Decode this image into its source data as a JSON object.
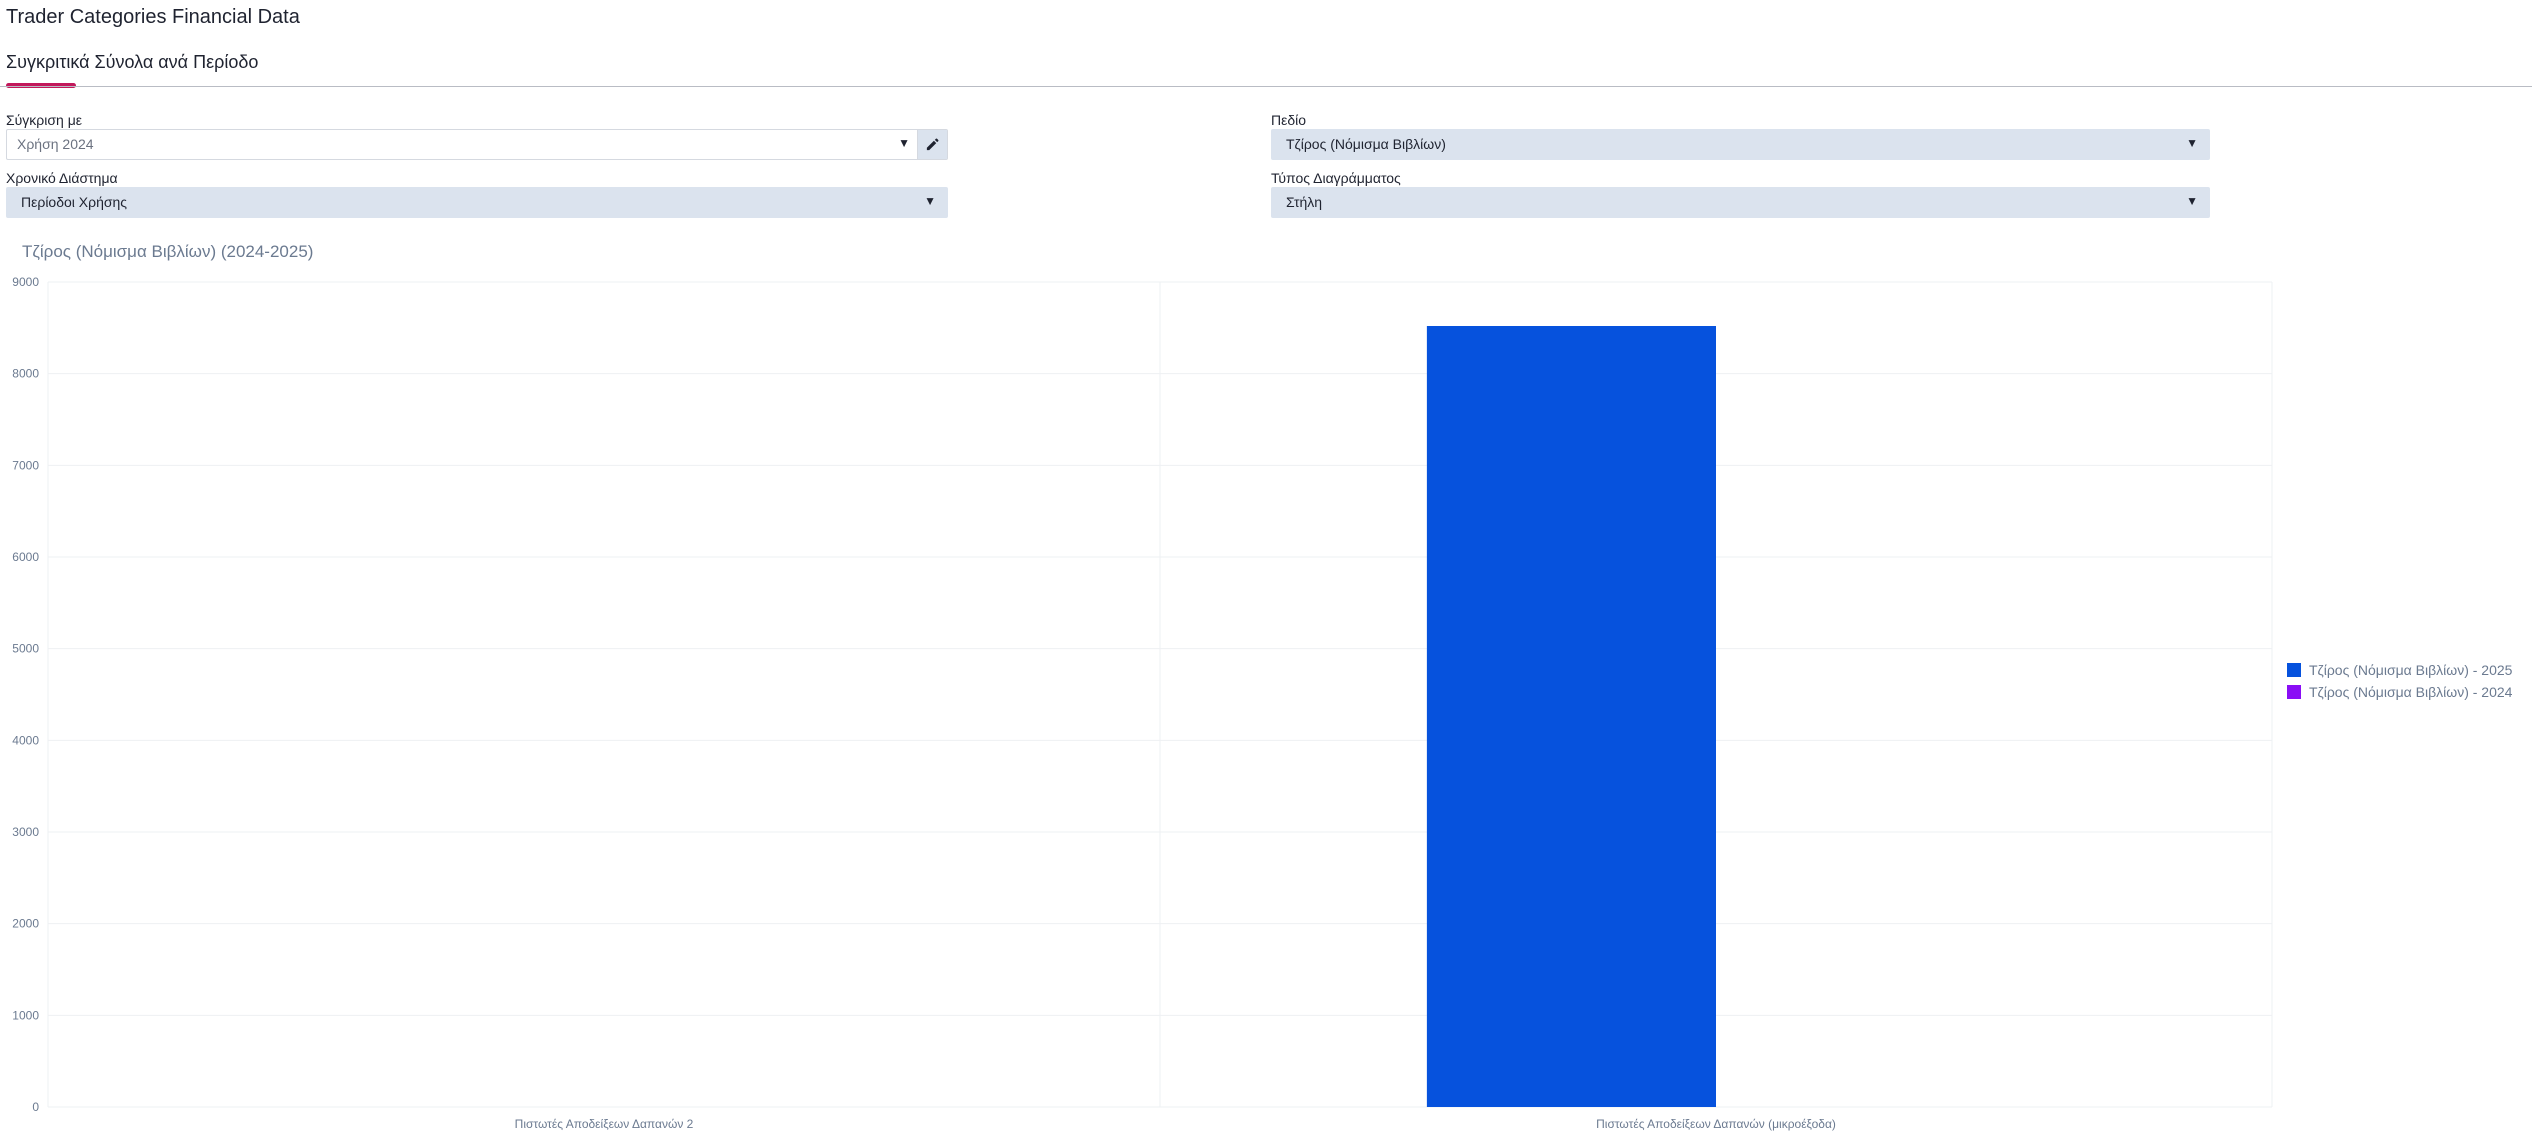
{
  "app": {
    "title": "Trader Categories Financial Data"
  },
  "tabs": [
    {
      "label": "Συγκριτικά Σύνολα ανά Περίοδο",
      "active": true
    }
  ],
  "filters": {
    "compare": {
      "label": "Σύγκριση με",
      "value": "Χρήση 2024"
    },
    "field": {
      "label": "Πεδίο",
      "value": "Τζίρος (Νόμισμα Βιβλίων)"
    },
    "period": {
      "label": "Χρονικό Διάστημα",
      "value": "Περίοδοι Χρήσης"
    },
    "chart_type": {
      "label": "Τύπος Διαγράμματος",
      "value": "Στήλη"
    }
  },
  "icons": {
    "dropdown": "chevron-down-icon",
    "edit": "pencil-icon"
  },
  "colors": {
    "accent": "#c2185b",
    "series_2025": "#0652dd",
    "series_2024": "#8a0ef5"
  },
  "chart_data": {
    "type": "bar",
    "title": "Τζίρος (Νόμισμα Βιβλίων) (2024-2025)",
    "xlabel": "",
    "ylabel": "",
    "ylim": [
      0,
      9000
    ],
    "yticks": [
      0,
      1000,
      2000,
      3000,
      4000,
      5000,
      6000,
      7000,
      8000,
      9000
    ],
    "grid": true,
    "legend_position": "right",
    "categories": [
      "Πιστωτές Αποδείξεων Δαπανών 2",
      "Πιστωτές Αποδείξεων Δαπανών (μικροέξοδα)"
    ],
    "series": [
      {
        "name": "Τζίρος (Νόμισμα Βιβλίων) - 2025",
        "color": "#0652dd",
        "values": [
          0,
          8520
        ]
      },
      {
        "name": "Τζίρος (Νόμισμα Βιβλίων) - 2024",
        "color": "#8a0ef5",
        "values": [
          0,
          0
        ]
      }
    ]
  }
}
